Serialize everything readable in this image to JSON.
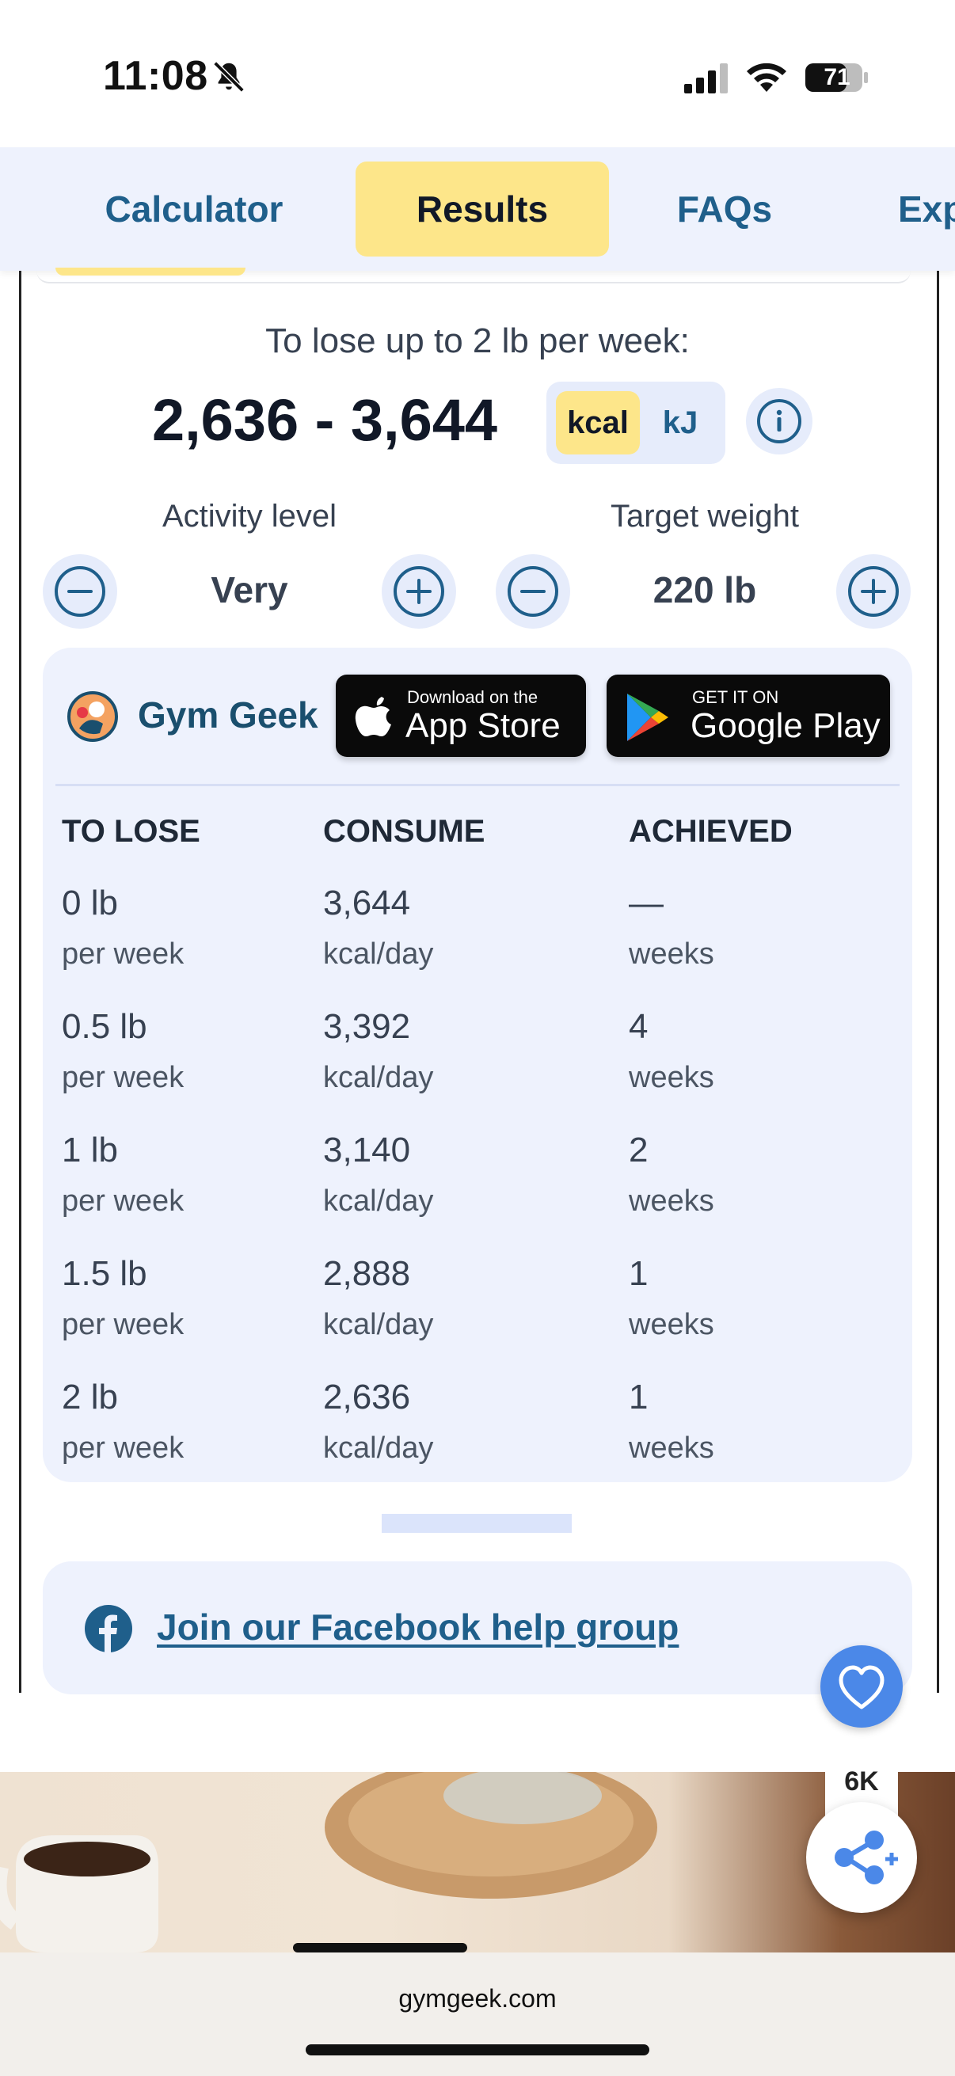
{
  "status_bar": {
    "time": "11:08",
    "battery": "71"
  },
  "tabs": [
    {
      "label": "Calculator"
    },
    {
      "label": "Results"
    },
    {
      "label": "FAQs"
    },
    {
      "label": "Exp"
    }
  ],
  "results": {
    "goal_label": "To lose up to 2 lb per week:",
    "range": "2,636 - 3,644",
    "units": {
      "kcal": "kcal",
      "kj": "kJ",
      "selected": "kcal"
    },
    "activity_label": "Activity level",
    "activity_value": "Very",
    "target_label": "Target weight",
    "target_value": "220 lb"
  },
  "brand": {
    "name": "Gym Geek",
    "appstore_small": "Download on the",
    "appstore_big": "App Store",
    "google_small": "GET IT ON",
    "google_big": "Google Play"
  },
  "table": {
    "headers": [
      "TO LOSE",
      "CONSUME",
      "ACHIEVED"
    ],
    "rows": [
      {
        "lose": "0 lb",
        "lose_unit": "per week",
        "consume": "3,644",
        "consume_unit": "kcal/day",
        "achieved": "—",
        "achieved_unit": "weeks"
      },
      {
        "lose": "0.5 lb",
        "lose_unit": "per week",
        "consume": "3,392",
        "consume_unit": "kcal/day",
        "achieved": "4",
        "achieved_unit": "weeks"
      },
      {
        "lose": "1 lb",
        "lose_unit": "per week",
        "consume": "3,140",
        "consume_unit": "kcal/day",
        "achieved": "2",
        "achieved_unit": "weeks"
      },
      {
        "lose": "1.5 lb",
        "lose_unit": "per week",
        "consume": "2,888",
        "consume_unit": "kcal/day",
        "achieved": "1",
        "achieved_unit": "weeks"
      },
      {
        "lose": "2 lb",
        "lose_unit": "per week",
        "consume": "2,636",
        "consume_unit": "kcal/day",
        "achieved": "1",
        "achieved_unit": "weeks"
      }
    ]
  },
  "facebook": {
    "link_text": "Join our Facebook help group"
  },
  "floating": {
    "share_count": "6K"
  },
  "browser": {
    "url": "gymgeek.com"
  },
  "colors": {
    "accent": "#1f5f8b",
    "highlight": "#fde68a",
    "card": "#eef2fd",
    "heart": "#4b88e8"
  }
}
